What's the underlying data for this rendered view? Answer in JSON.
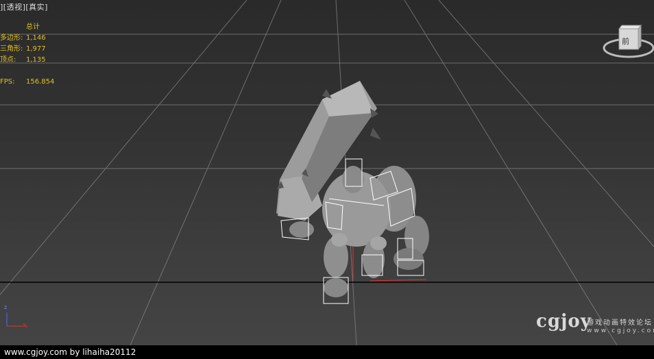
{
  "viewport": {
    "label_parts": [
      "]",
      "[透视]",
      "[真实]"
    ],
    "stats": {
      "header": "总计",
      "rows": [
        {
          "key": "多边形:",
          "value": "1,146"
        },
        {
          "key": "三角形:",
          "value": "1,977"
        },
        {
          "key": "顶点:",
          "value": "1,135"
        }
      ],
      "fps_label": "FPS:",
      "fps_value": "156.854"
    },
    "viewcube_label": "前",
    "axis_label": "z"
  },
  "watermark": {
    "logo": "cgjoy",
    "cn": "游戏动画特效论坛",
    "url": "www.cgjoy.com"
  },
  "status_bar": {
    "text": "www.cgjoy.com by lihaiha20112"
  }
}
